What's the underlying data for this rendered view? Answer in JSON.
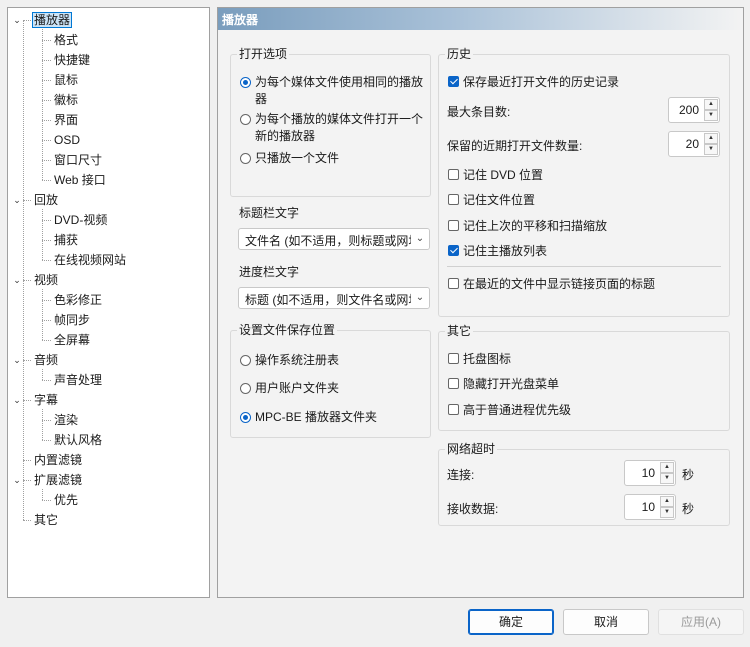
{
  "tree": {
    "items": [
      {
        "label": "播放器",
        "level": 0,
        "selected": true,
        "expanded": true
      },
      {
        "label": "格式",
        "level": 1
      },
      {
        "label": "快捷键",
        "level": 1
      },
      {
        "label": "鼠标",
        "level": 1
      },
      {
        "label": "徽标",
        "level": 1
      },
      {
        "label": "界面",
        "level": 1
      },
      {
        "label": "OSD",
        "level": 1
      },
      {
        "label": "窗口尺寸",
        "level": 1
      },
      {
        "label": "Web 接口",
        "level": 1
      },
      {
        "label": "回放",
        "level": 0,
        "expanded": true
      },
      {
        "label": "DVD-视频",
        "level": 1
      },
      {
        "label": "捕获",
        "level": 1
      },
      {
        "label": "在线视频网站",
        "level": 1
      },
      {
        "label": "视频",
        "level": 0,
        "expanded": true
      },
      {
        "label": "色彩修正",
        "level": 1
      },
      {
        "label": "帧同步",
        "level": 1
      },
      {
        "label": "全屏幕",
        "level": 1
      },
      {
        "label": "音频",
        "level": 0,
        "expanded": true
      },
      {
        "label": "声音处理",
        "level": 1
      },
      {
        "label": "字幕",
        "level": 0,
        "expanded": true
      },
      {
        "label": "渲染",
        "level": 1
      },
      {
        "label": "默认风格",
        "level": 1
      },
      {
        "label": "内置滤镜",
        "level": 0
      },
      {
        "label": "扩展滤镜",
        "level": 0,
        "expanded": true
      },
      {
        "label": "优先",
        "level": 1
      },
      {
        "label": "其它",
        "level": 0
      }
    ]
  },
  "panel": {
    "title": "播放器",
    "open_options": {
      "title": "打开选项",
      "opt_same": "为每个媒体文件使用相同的播放器",
      "opt_same_l1": "为每个媒体文件使用相同的播放",
      "opt_same_l2": "器",
      "opt_new_l1": "为每个播放的媒体文件打开一个",
      "opt_new_l2": "新的播放器",
      "opt_single": "只播放一个文件"
    },
    "titlebar": {
      "label": "标题栏文字",
      "value": "文件名 (如不适用，则标题或网址)"
    },
    "seekbar": {
      "label": "进度栏文字",
      "value": "标题 (如不适用，则文件名或网址)"
    },
    "save_location": {
      "title": "设置文件保存位置",
      "opt_registry": "操作系统注册表",
      "opt_user": "用户账户文件夹",
      "opt_app": "MPC-BE 播放器文件夹"
    },
    "history": {
      "title": "历史",
      "keep_recent": "保存最近打开文件的历史记录",
      "max_items_label": "最大条目数:",
      "max_items_value": "200",
      "recent_count_label": "保留的近期打开文件数量:",
      "recent_count_value": "20",
      "remember_dvd": "记住 DVD 位置",
      "remember_file": "记住文件位置",
      "remember_pan": "记住上次的平移和扫描缩放",
      "remember_playlist": "记住主播放列表",
      "show_link_title": "在最近的文件中显示链接页面的标题"
    },
    "other": {
      "title": "其它",
      "tray_icon": "托盘图标",
      "hide_cd_menu": "隐藏打开光盘菜单",
      "high_priority": "高于普通进程优先级"
    },
    "network": {
      "title": "网络超时",
      "connect_label": "连接:",
      "connect_value": "10",
      "receive_label": "接收数据:",
      "receive_value": "10",
      "unit": "秒"
    }
  },
  "buttons": {
    "ok": "确定",
    "cancel": "取消",
    "apply": "应用(A)"
  },
  "colors": {
    "accent": "#0a64c8",
    "title_gradient_start": "#7a9dbd"
  }
}
